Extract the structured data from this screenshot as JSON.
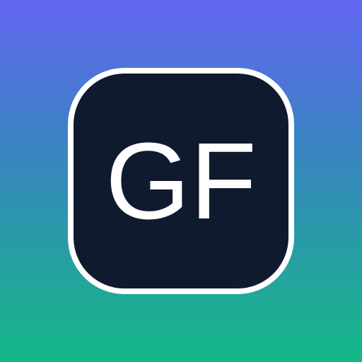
{
  "icon": {
    "monogram": "GF",
    "colors": {
      "gradient_top": "#6366f1",
      "gradient_bottom": "#14b886",
      "tile_fill": "#0f1a2e",
      "tile_border": "#ffffff",
      "text": "#ffffff"
    }
  }
}
